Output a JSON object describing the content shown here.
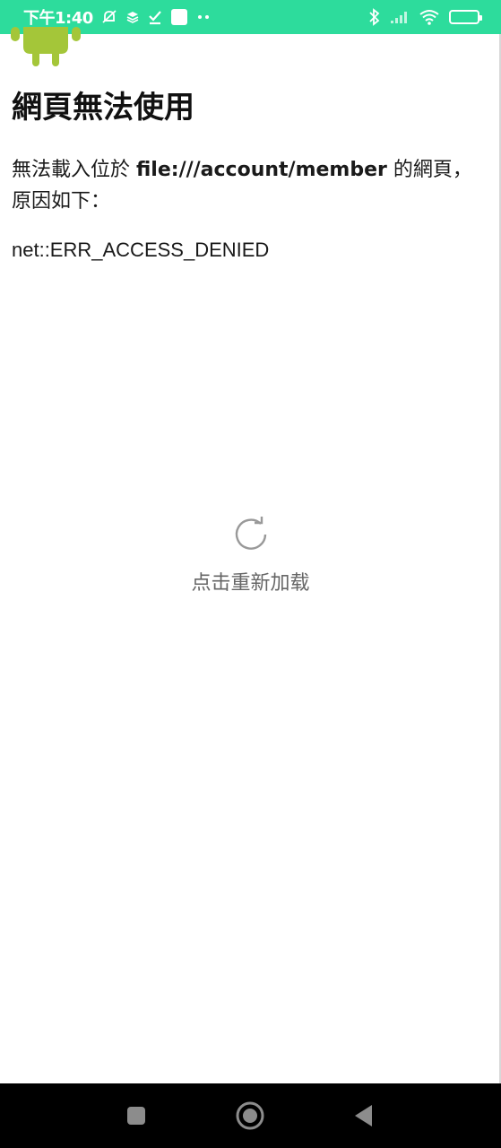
{
  "status_bar": {
    "time": "下午1:40",
    "background": "#2ddc9c",
    "battery_level": "80",
    "battery_fraction": 0.8,
    "icons_left": [
      "muted-bell-icon",
      "layers-icon",
      "check-icon",
      "square-icon",
      "dots-icon"
    ],
    "icons_right": [
      "bluetooth-icon",
      "signal-icon",
      "wifi-icon",
      "battery-icon"
    ]
  },
  "error_page": {
    "logo": "android-logo",
    "title": "網頁無法使用",
    "desc_before": "無法載入位於 ",
    "url": "file:///account/member",
    "desc_after": " 的網頁，原因如下：",
    "error_code": "net::ERR_ACCESS_DENIED"
  },
  "reload": {
    "icon": "refresh-icon",
    "label": "点击重新加载"
  },
  "nav_bar": {
    "buttons": [
      "recents-icon",
      "home-icon",
      "back-icon"
    ]
  }
}
